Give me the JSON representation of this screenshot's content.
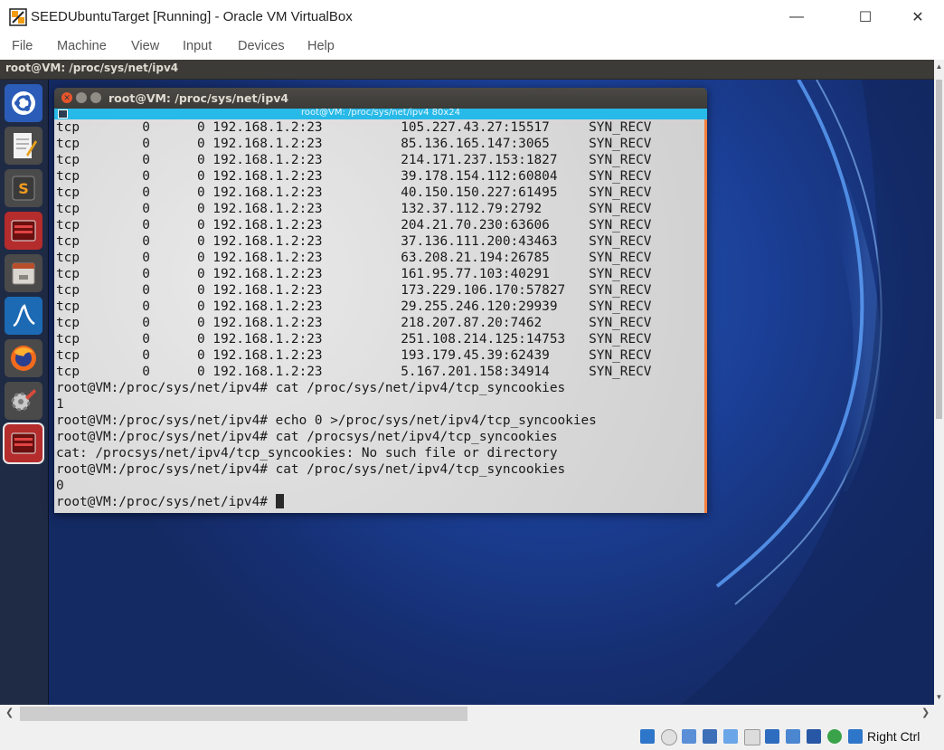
{
  "window": {
    "title": "SEEDUbuntuTarget [Running] - Oracle VM VirtualBox",
    "minimize": "—",
    "maximize": "☐",
    "close": "✕"
  },
  "menu": [
    "File",
    "Machine",
    "View",
    "Input",
    "Devices",
    "Help"
  ],
  "ubuntu_panel": {
    "title": "root@VM: /proc/sys/net/ipv4"
  },
  "terminal": {
    "title": "root@VM: /proc/sys/net/ipv4",
    "subtitle": "root@VM: /proc/sys/net/ipv4 80x24",
    "lines": [
      "tcp        0      0 192.168.1.2:23          105.227.43.27:15517     SYN_RECV",
      "tcp        0      0 192.168.1.2:23          85.136.165.147:3065     SYN_RECV",
      "tcp        0      0 192.168.1.2:23          214.171.237.153:1827    SYN_RECV",
      "tcp        0      0 192.168.1.2:23          39.178.154.112:60804    SYN_RECV",
      "tcp        0      0 192.168.1.2:23          40.150.150.227:61495    SYN_RECV",
      "tcp        0      0 192.168.1.2:23          132.37.112.79:2792      SYN_RECV",
      "tcp        0      0 192.168.1.2:23          204.21.70.230:63606     SYN_RECV",
      "tcp        0      0 192.168.1.2:23          37.136.111.200:43463    SYN_RECV",
      "tcp        0      0 192.168.1.2:23          63.208.21.194:26785     SYN_RECV",
      "tcp        0      0 192.168.1.2:23          161.95.77.103:40291     SYN_RECV",
      "tcp        0      0 192.168.1.2:23          173.229.106.170:57827   SYN_RECV",
      "tcp        0      0 192.168.1.2:23          29.255.246.120:29939    SYN_RECV",
      "tcp        0      0 192.168.1.2:23          218.207.87.20:7462      SYN_RECV",
      "tcp        0      0 192.168.1.2:23          251.108.214.125:14753   SYN_RECV",
      "tcp        0      0 192.168.1.2:23          193.179.45.39:62439     SYN_RECV",
      "tcp        0      0 192.168.1.2:23          5.167.201.158:34914     SYN_RECV",
      "root@VM:/proc/sys/net/ipv4# cat /proc/sys/net/ipv4/tcp_syncookies",
      "1",
      "root@VM:/proc/sys/net/ipv4# echo 0 >/proc/sys/net/ipv4/tcp_syncookies",
      "root@VM:/proc/sys/net/ipv4# cat /procsys/net/ipv4/tcp_syncookies",
      "cat: /procsys/net/ipv4/tcp_syncookies: No such file or directory",
      "root@VM:/proc/sys/net/ipv4# cat /proc/sys/net/ipv4/tcp_syncookies",
      "0"
    ],
    "prompt": "root@VM:/proc/sys/net/ipv4# "
  },
  "launcher_icons": [
    "ubuntu-dash-icon",
    "text-editor-icon",
    "sublime-text-icon",
    "terminal-icon",
    "file-manager-icon",
    "wireshark-icon",
    "firefox-icon",
    "system-settings-icon",
    "terminal-active-icon"
  ],
  "status": {
    "host_key": "Right Ctrl"
  },
  "colors": {
    "ubuntu_panel": "#3c3b37",
    "desktop": "#1c3a86",
    "terminal_subbar": "#27b9e8",
    "terminal_accent": "#f47f3d"
  }
}
